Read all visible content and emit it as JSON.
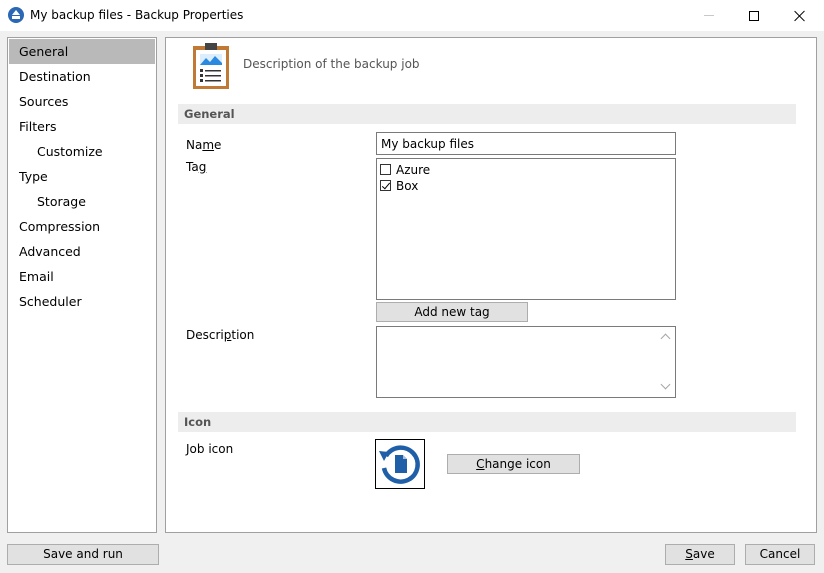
{
  "window": {
    "title": "My backup files - Backup Properties"
  },
  "sidebar": {
    "items": [
      {
        "label": "General",
        "selected": true,
        "sub": false
      },
      {
        "label": "Destination",
        "sub": false
      },
      {
        "label": "Sources",
        "sub": false
      },
      {
        "label": "Filters",
        "sub": false
      },
      {
        "label": "Customize",
        "sub": true
      },
      {
        "label": "Type",
        "sub": false
      },
      {
        "label": "Storage",
        "sub": true
      },
      {
        "label": "Compression",
        "sub": false
      },
      {
        "label": "Advanced",
        "sub": false
      },
      {
        "label": "Email",
        "sub": false
      },
      {
        "label": "Scheduler",
        "sub": false
      }
    ]
  },
  "header": {
    "description": "Description of the backup job",
    "icon": "clipboard-report-icon"
  },
  "general_section": {
    "title": "General",
    "name_label_pre": "Na",
    "name_label_u": "m",
    "name_label_post": "e",
    "name_value": "My backup files",
    "tag_label_pre": "Ta",
    "tag_label_u": "g",
    "tag_label_post": "",
    "tags": [
      {
        "label": "Azure",
        "checked": false
      },
      {
        "label": "Box",
        "checked": true
      }
    ],
    "add_tag_label": "Add new tag",
    "description_label_pre": "Descri",
    "description_label_u": "p",
    "description_label_post": "tion",
    "description_value": ""
  },
  "icon_section": {
    "title": "Icon",
    "job_icon_label": "Job icon",
    "job_icon": "restore-file-icon",
    "change_icon_u": "C",
    "change_icon_post": "hange icon"
  },
  "footer": {
    "save_and_run_label": "Save and run",
    "save_u": "S",
    "save_post": "ave",
    "cancel_label": "Cancel"
  },
  "colors": {
    "accent": "#2a67b4",
    "selected_nav": "#b9b9b9",
    "section_bar": "#ededed"
  }
}
